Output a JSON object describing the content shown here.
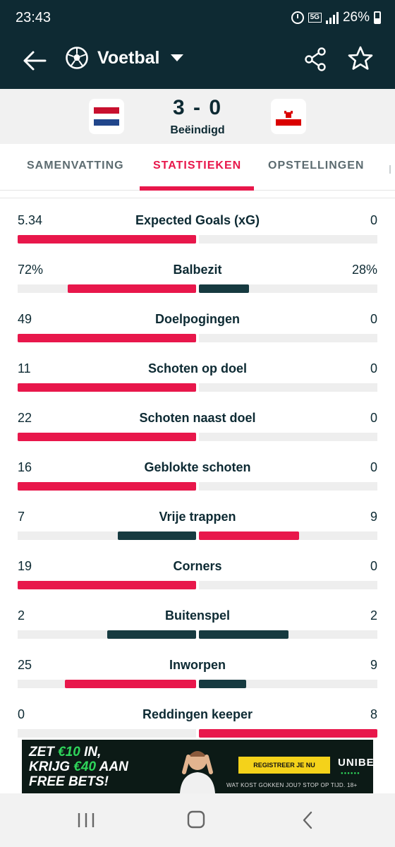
{
  "status_bar": {
    "time": "23:43",
    "network": "5G",
    "battery": "26%"
  },
  "header": {
    "sport": "Voetbal",
    "icons": [
      "back-arrow-icon",
      "soccer-ball-icon",
      "chevron-down-icon",
      "share-icon",
      "star-icon"
    ]
  },
  "match": {
    "score": "3 - 0",
    "status": "Beëindigd",
    "home_flag": "netherlands-flag",
    "away_flag": "gibraltar-flag"
  },
  "tabs": [
    {
      "label": "SAMENVATTING",
      "active": false
    },
    {
      "label": "STATISTIEKEN",
      "active": true
    },
    {
      "label": "OPSTELLINGEN",
      "active": false
    }
  ],
  "colors": {
    "accent": "#e8174b",
    "dark": "#0e2a33",
    "bar_dark": "#163a40",
    "track": "#eeeeee"
  },
  "stats": [
    {
      "name": "Expected Goals (xG)",
      "home": "5.34",
      "away": "0",
      "home_frac": 1.0,
      "away_frac": 0.0,
      "home_color": "accent",
      "away_color": "dark"
    },
    {
      "name": "Balbezit",
      "home": "72%",
      "away": "28%",
      "home_frac": 0.72,
      "away_frac": 0.28,
      "home_color": "accent",
      "away_color": "dark"
    },
    {
      "name": "Doelpogingen",
      "home": "49",
      "away": "0",
      "home_frac": 1.0,
      "away_frac": 0.0,
      "home_color": "accent",
      "away_color": "dark"
    },
    {
      "name": "Schoten op doel",
      "home": "11",
      "away": "0",
      "home_frac": 1.0,
      "away_frac": 0.0,
      "home_color": "accent",
      "away_color": "dark"
    },
    {
      "name": "Schoten naast doel",
      "home": "22",
      "away": "0",
      "home_frac": 1.0,
      "away_frac": 0.0,
      "home_color": "accent",
      "away_color": "dark"
    },
    {
      "name": "Geblokte schoten",
      "home": "16",
      "away": "0",
      "home_frac": 1.0,
      "away_frac": 0.0,
      "home_color": "accent",
      "away_color": "dark"
    },
    {
      "name": "Vrije trappen",
      "home": "7",
      "away": "9",
      "home_frac": 0.4375,
      "away_frac": 0.5625,
      "home_color": "dark",
      "away_color": "accent"
    },
    {
      "name": "Corners",
      "home": "19",
      "away": "0",
      "home_frac": 1.0,
      "away_frac": 0.0,
      "home_color": "accent",
      "away_color": "dark"
    },
    {
      "name": "Buitenspel",
      "home": "2",
      "away": "2",
      "home_frac": 0.5,
      "away_frac": 0.5,
      "home_color": "dark",
      "away_color": "dark"
    },
    {
      "name": "Inworpen",
      "home": "25",
      "away": "9",
      "home_frac": 0.735,
      "away_frac": 0.265,
      "home_color": "accent",
      "away_color": "dark"
    },
    {
      "name": "Reddingen keeper",
      "home": "0",
      "away": "8",
      "home_frac": 0.0,
      "away_frac": 1.0,
      "home_color": "dark",
      "away_color": "accent"
    }
  ],
  "ad": {
    "line1_a": "ZET ",
    "line1_b": "€10",
    "line1_c": " IN,",
    "line2_a": "KRIJG ",
    "line2_b": "€40",
    "line2_c": " AAN",
    "line3": "FREE BETS!",
    "cta": "REGISTREER JE NU",
    "brand": "UNIBET",
    "disclaimer": "WAT KOST GOKKEN JOU? STOP OP TIJD. 18+"
  },
  "nav": {
    "icons": [
      "recent-apps-icon",
      "home-icon",
      "back-icon"
    ]
  }
}
